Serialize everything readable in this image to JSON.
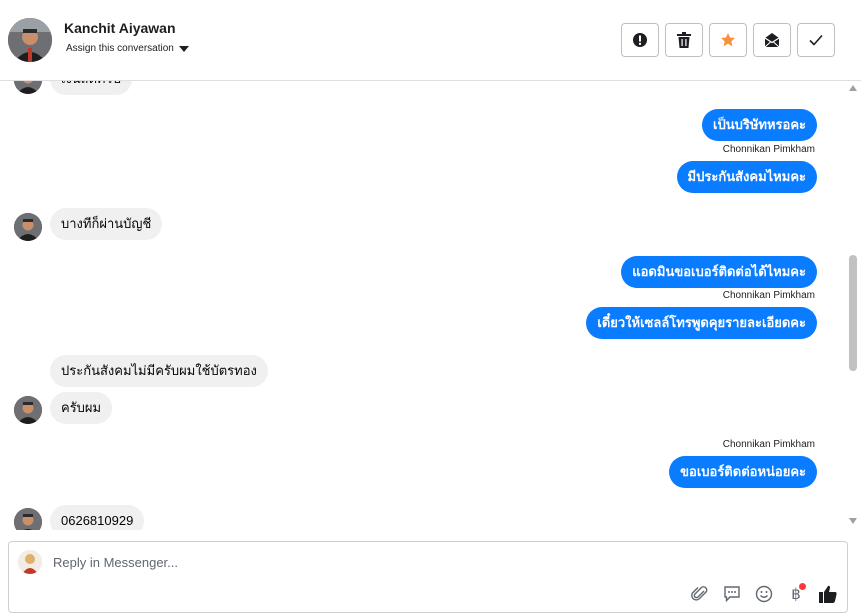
{
  "header": {
    "contact_name": "Kanchit Aiyawan",
    "assign_label": "Assign this conversation",
    "actions": [
      {
        "name": "mark-spam",
        "icon": "alert-circle-icon"
      },
      {
        "name": "delete",
        "icon": "trash-icon"
      },
      {
        "name": "star",
        "icon": "star-icon",
        "color": "#f7923b"
      },
      {
        "name": "mark-unread",
        "icon": "envelope-icon"
      },
      {
        "name": "mark-done",
        "icon": "checkmark-icon"
      }
    ]
  },
  "thread": {
    "messages": [
      {
        "direction": "in",
        "text": "เงินสดครับ",
        "avatar": true
      },
      {
        "direction": "out",
        "text": "เป็นบริษัทหรอคะ",
        "sender": "Chonnikan Pimkham"
      },
      {
        "direction": "out",
        "text": "มีประกันสังคมไหมคะ"
      },
      {
        "direction": "in",
        "text": "บางทีก็ผ่านบัญชี",
        "avatar": true
      },
      {
        "direction": "out",
        "text": "แอดมินขอเบอร์ติดต่อได้ไหมคะ",
        "sender": "Chonnikan Pimkham"
      },
      {
        "direction": "out",
        "text": "เดี๋ยวให้เซลล์โทรพูดคุยรายละเอียดคะ"
      },
      {
        "direction": "in",
        "text": "ประกันสังคมไม่มีครับผมใช้บัตรทอง"
      },
      {
        "direction": "in",
        "text": "ครับผม",
        "avatar": true
      },
      {
        "direction": "out",
        "text": "ขอเบอร์ติดต่อหน่อยคะ",
        "sender": "Chonnikan Pimkham"
      },
      {
        "direction": "in",
        "text": "0626810929",
        "avatar": true
      }
    ]
  },
  "composer": {
    "placeholder": "Reply in Messenger...",
    "tools": [
      "paperclip-icon",
      "saved-reply-icon",
      "emoji-icon",
      "baht-payment-icon",
      "thumbs-up-icon"
    ]
  },
  "colors": {
    "outgoing_bubble": "#0a7cff",
    "incoming_bubble": "#f0f0f0",
    "star": "#f7923b",
    "notification_dot": "#fa383e"
  }
}
